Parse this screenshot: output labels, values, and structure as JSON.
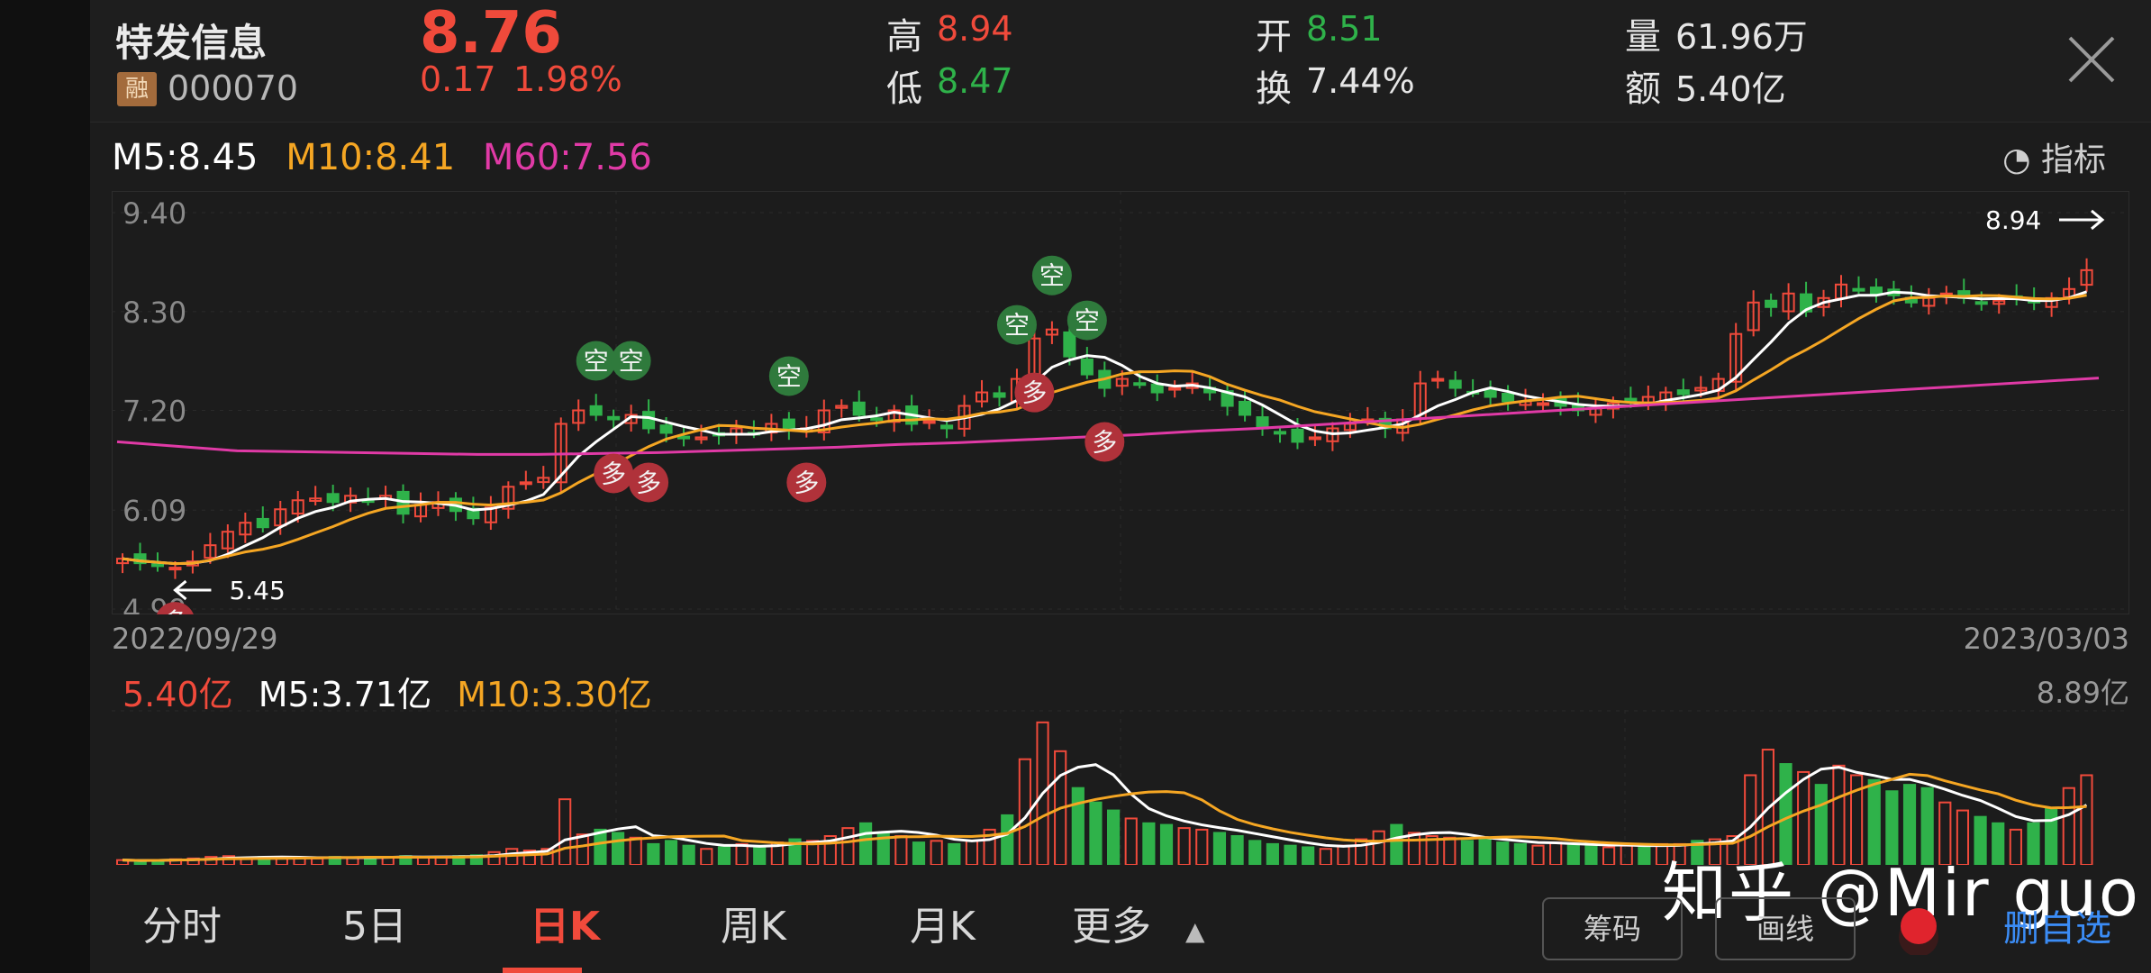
{
  "stock": {
    "name": "特发信息",
    "badge": "融",
    "code": "000070",
    "price": "8.76",
    "change": "0.17",
    "change_pct": "1.98%",
    "quote": {
      "high_label": "高",
      "high": "8.94",
      "low_label": "低",
      "low": "8.47",
      "open_label": "开",
      "open": "8.51",
      "turnover_label": "换",
      "turnover": "7.44%",
      "volume_label": "量",
      "volume": "61.96万",
      "amount_label": "额",
      "amount": "5.40亿"
    }
  },
  "indicators": {
    "m5": "M5:8.45",
    "m10": "M10:8.41",
    "m60": "M60:7.56",
    "button": "指标"
  },
  "volume_panel": {
    "amount": "5.40亿",
    "m5": "M5:3.71亿",
    "m10": "M10:3.30亿",
    "max": "8.89亿"
  },
  "dates": {
    "start": "2022/09/29",
    "end": "2023/03/03"
  },
  "signals": {
    "buy": "多",
    "sell": "空"
  },
  "tabs": [
    "分时",
    "5日",
    "日K",
    "周K",
    "月K",
    "更多"
  ],
  "tools": {
    "chip": "筹码",
    "draw": "画线",
    "remove": "删自选"
  },
  "watermark": "知乎 @Mir guo",
  "colors": {
    "up": "#f04a3b",
    "down": "#2fb24a",
    "m5": "#ffffff",
    "m10": "#f5a623",
    "m60": "#e03aa6"
  },
  "chart_data": {
    "type": "candlestick",
    "y_ticks": [
      "9.40",
      "8.30",
      "7.20",
      "6.09",
      "4.99"
    ],
    "ylim": [
      4.99,
      9.4
    ],
    "max_marker": "8.94",
    "min_marker": "5.45",
    "close": [
      5.55,
      5.5,
      5.48,
      5.45,
      5.52,
      5.7,
      5.85,
      5.95,
      5.9,
      6.1,
      6.2,
      6.22,
      6.18,
      6.25,
      6.2,
      6.25,
      6.05,
      6.15,
      6.18,
      6.08,
      6.0,
      6.12,
      6.35,
      6.4,
      6.45,
      7.05,
      7.2,
      7.15,
      7.1,
      7.15,
      7.0,
      6.95,
      6.9,
      6.9,
      6.92,
      7.0,
      6.95,
      7.05,
      6.98,
      7.0,
      7.2,
      7.25,
      7.15,
      7.1,
      7.2,
      7.05,
      7.08,
      7.0,
      7.25,
      7.4,
      7.35,
      7.55,
      8.0,
      8.1,
      7.8,
      7.6,
      7.45,
      7.55,
      7.5,
      7.4,
      7.45,
      7.5,
      7.4,
      7.25,
      7.15,
      7.0,
      6.95,
      6.85,
      6.9,
      7.0,
      7.05,
      7.1,
      7.0,
      7.1,
      7.5,
      7.55,
      7.45,
      7.4,
      7.35,
      7.3,
      7.3,
      7.28,
      7.25,
      7.2,
      7.22,
      7.28,
      7.3,
      7.35,
      7.4,
      7.38,
      7.45,
      7.55,
      8.05,
      8.4,
      8.35,
      8.5,
      8.3,
      8.45,
      8.6,
      8.55,
      8.5,
      8.48,
      8.4,
      8.45,
      8.5,
      8.45,
      8.4,
      8.42,
      8.44,
      8.4,
      8.45,
      8.55,
      8.76
    ],
    "ma60": [
      6.85,
      6.8,
      6.75,
      6.74,
      6.73,
      6.72,
      6.71,
      6.71,
      6.72,
      6.73,
      6.75,
      6.77,
      6.79,
      6.82,
      6.84,
      6.87,
      6.9,
      6.93,
      6.97,
      7.0,
      7.04,
      7.08,
      7.12,
      7.16,
      7.2,
      7.24,
      7.28,
      7.32,
      7.36,
      7.4,
      7.44,
      7.48,
      7.52,
      7.56
    ],
    "volume": [
      0.3,
      0.25,
      0.3,
      0.35,
      0.4,
      0.5,
      0.55,
      0.45,
      0.5,
      0.45,
      0.45,
      0.4,
      0.5,
      0.45,
      0.5,
      0.5,
      0.55,
      0.45,
      0.5,
      0.55,
      0.6,
      0.8,
      1.0,
      0.9,
      1.0,
      4.1,
      1.9,
      2.2,
      2.0,
      1.7,
      1.3,
      1.5,
      1.2,
      1.0,
      1.1,
      1.3,
      1.2,
      1.4,
      1.6,
      1.5,
      1.8,
      2.3,
      2.6,
      2.0,
      1.8,
      1.4,
      1.5,
      1.3,
      1.5,
      2.2,
      3.1,
      6.6,
      8.9,
      7.1,
      4.8,
      3.9,
      3.4,
      2.9,
      2.6,
      2.5,
      2.3,
      2.2,
      2.0,
      1.8,
      1.5,
      1.3,
      1.2,
      1.1,
      1.0,
      1.2,
      1.6,
      2.1,
      2.5,
      2.0,
      1.8,
      1.7,
      1.5,
      1.6,
      1.4,
      1.3,
      1.2,
      1.4,
      1.3,
      1.2,
      1.1,
      1.2,
      1.2,
      1.3,
      1.3,
      1.5,
      1.6,
      1.8,
      5.6,
      7.2,
      6.3,
      5.8,
      5.0,
      6.2,
      5.6,
      5.3,
      4.6,
      5.0,
      4.8,
      3.9,
      3.4,
      3.0,
      2.6,
      2.2,
      2.6,
      3.5,
      4.8,
      5.6
    ]
  }
}
